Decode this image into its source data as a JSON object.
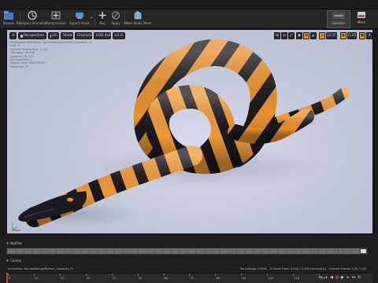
{
  "toolbar": {
    "items": [
      {
        "name": "browse",
        "label": "Browse"
      },
      {
        "name": "preview-animation",
        "label": "Reimport Animation"
      },
      {
        "name": "compression",
        "label": "Compression"
      },
      {
        "name": "export-asset",
        "label": "Export Asset"
      },
      {
        "name": "key",
        "label": "Key"
      },
      {
        "name": "apply",
        "label": "Apply"
      },
      {
        "name": "make-static-mesh",
        "label": "Make Static Mesh"
      }
    ],
    "right": [
      {
        "name": "skeleton",
        "label": "Skeleton"
      },
      {
        "name": "mesh",
        "label": "Mesh"
      }
    ]
  },
  "viewport": {
    "buttons": {
      "menu": "≡",
      "perspective": "Perspective",
      "lit": "Lit",
      "show": "Show",
      "character": "Character",
      "lod": "LOD Auto",
      "speed": "x1.0"
    },
    "right_controls": [
      "⊕",
      "⊘",
      "⤢",
      "◉",
      "⊞",
      "◭",
      "⊿",
      "22.5°",
      "◉",
      "0.25",
      "▣",
      "4"
    ],
    "info_lines": [
      "Previewing Animation: BandedBengalPython_Constrict_01",
      "LOD: 0",
      "Current Screen Size: 1.013",
      "Triangles: 76,398",
      "Vertices: 76,979",
      "UV Channels: 1",
      "Approx Size: 86x379x46",
      "Materials: 01"
    ]
  },
  "bottom": {
    "notifies_header": "Notifies",
    "notifies_track_number": "1",
    "curves_header": "Curves",
    "status": {
      "animation": "Animation: BandedBengalPython_Constrict_01",
      "percentage": "Percentage: 0.00%",
      "current_time": "Current Time: 0.000 / 4.300 (second(s))",
      "current_frame": "Current Frame: 0.00 / 128 Frames"
    },
    "tick_labels": [
      "0",
      "10",
      "20",
      "30",
      "40",
      "50",
      "60",
      "70",
      "80",
      "90",
      "100",
      "110",
      "120"
    ]
  },
  "colors": {
    "accent": "#e38f2b",
    "scale_orange": "#e8902e",
    "scale_black": "#1d1a1d",
    "viewport_bg": "#c9cde0"
  }
}
